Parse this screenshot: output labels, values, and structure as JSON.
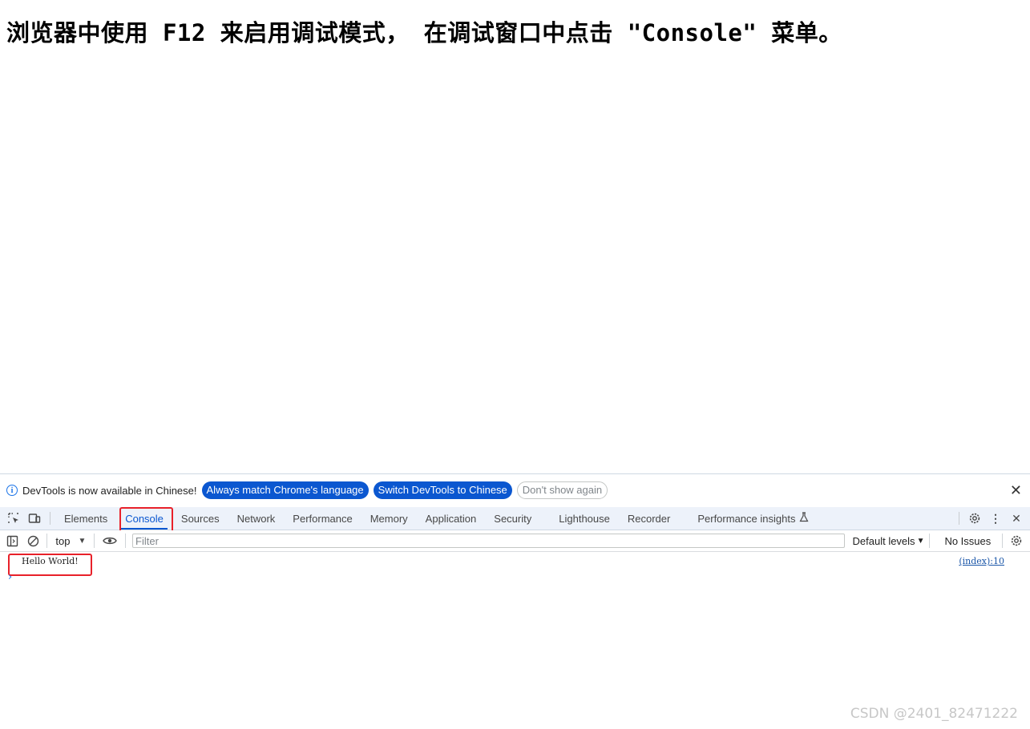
{
  "page": {
    "heading": "浏览器中使用 F12 来启用调试模式， 在调试窗口中点击 \"Console\" 菜单。"
  },
  "devtools": {
    "info_bar": {
      "icon": "info-icon",
      "message": "DevTools is now available in Chinese!",
      "buttons": {
        "always_match": "Always match Chrome's language",
        "switch_chinese": "Switch DevTools to Chinese",
        "dont_show": "Don't show again"
      },
      "close_icon": "close-icon"
    },
    "tabs": [
      {
        "label": "Elements"
      },
      {
        "label": "Console",
        "active": true
      },
      {
        "label": "Sources"
      },
      {
        "label": "Network"
      },
      {
        "label": "Performance"
      },
      {
        "label": "Memory"
      },
      {
        "label": "Application"
      },
      {
        "label": "Security"
      },
      {
        "label": "Lighthouse"
      },
      {
        "label": "Recorder"
      },
      {
        "label": "Performance insights"
      }
    ],
    "toolbar": {
      "context": "top",
      "filter_placeholder": "Filter",
      "levels": "Default levels",
      "issues": "No Issues"
    },
    "console": {
      "messages": [
        {
          "text": "Hello World!",
          "source": "(index):10"
        }
      ],
      "prompt": "›"
    },
    "colors": {
      "accent": "#0b57d0",
      "highlight": "#e8212a",
      "tab_bar_bg": "#edf2fa"
    }
  },
  "watermark": "CSDN @2401_82471222"
}
